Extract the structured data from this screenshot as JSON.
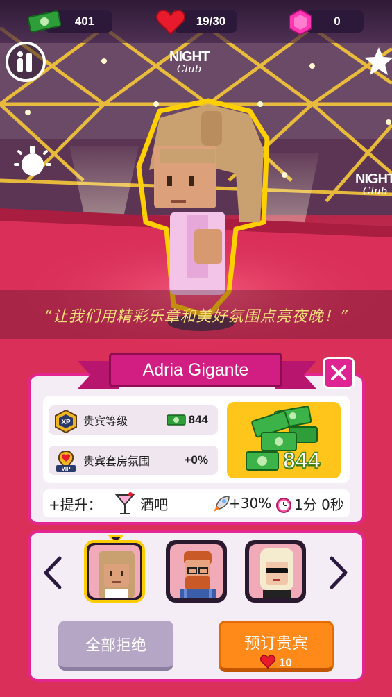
{
  "hud": {
    "cash": "401",
    "hearts": "19/30",
    "gems": "0"
  },
  "logo": {
    "line1": "NIGHT",
    "line2": "Club"
  },
  "quote": "“让我们用精彩乐章和美好氛围点亮夜晚！”",
  "guest": {
    "name": "Adria Gigante",
    "stats": [
      {
        "label": "贵宾等级",
        "value": "844",
        "icon": "xp-badge-icon"
      },
      {
        "label": "贵宾套房氛围",
        "value": "+0%",
        "icon": "vip-badge-icon"
      }
    ],
    "reward": "844"
  },
  "boost": {
    "prefix": "+提升：",
    "venue": "酒吧",
    "speed": "+30%",
    "time": "1分 0秒"
  },
  "buttons": {
    "reject_all": "全部拒绝",
    "book": "预订贵宾",
    "book_cost": "10"
  },
  "colors": {
    "accent": "#e3258f",
    "ribbon": "#d21e82",
    "reward_box": "#ffc51a",
    "book_button": "#ff8a1a",
    "reject_button": "#b4a6c4"
  }
}
